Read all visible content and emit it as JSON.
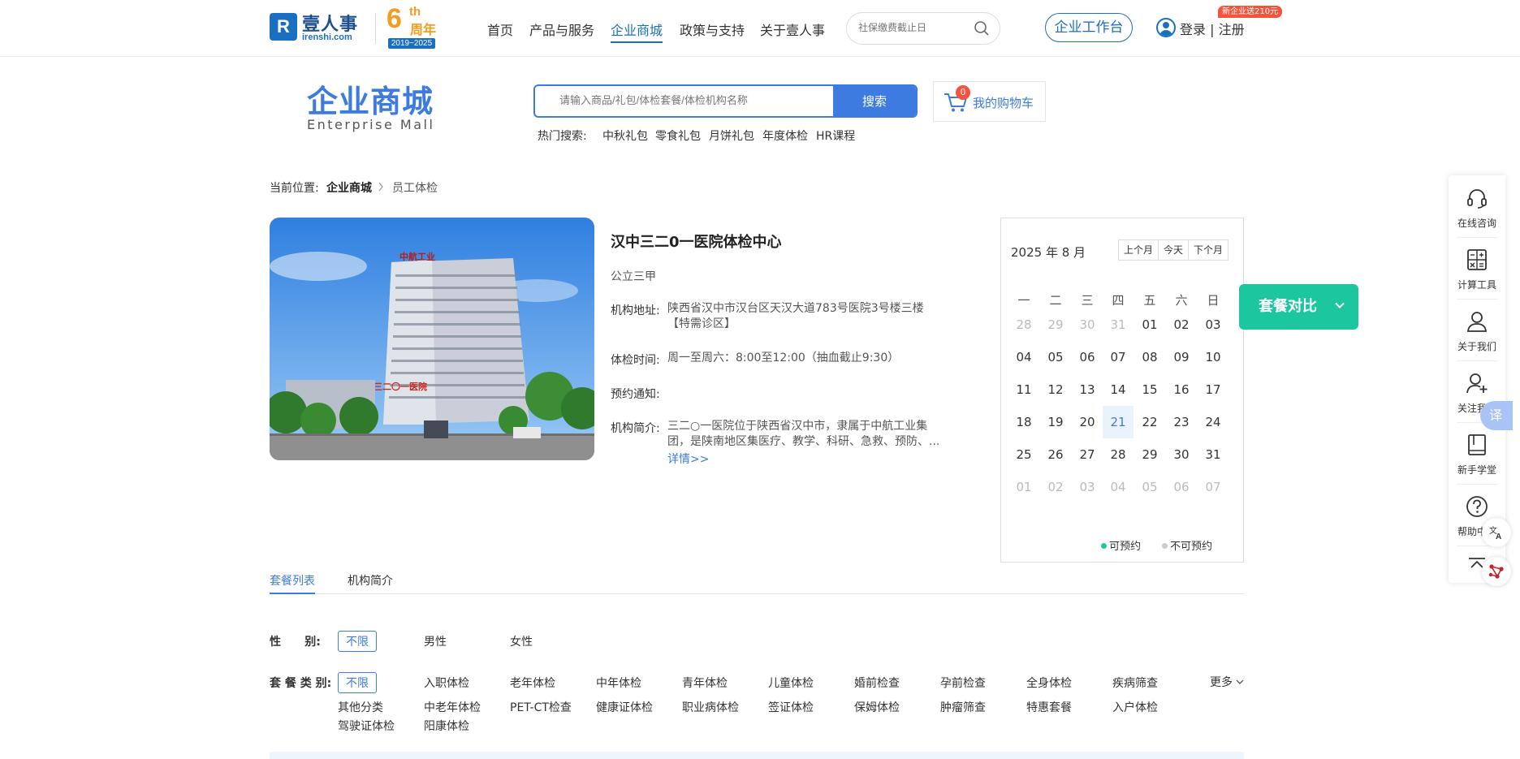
{
  "brand": {
    "name": "壹人事",
    "domain": "irenshi.com",
    "anniversary_num": "6",
    "anniversary_suffix": "th",
    "anniversary_label": "周年",
    "anniversary_years": "2019~2025"
  },
  "nav": {
    "items": [
      {
        "label": "首页",
        "active": false
      },
      {
        "label": "产品与服务",
        "active": false
      },
      {
        "label": "企业商城",
        "active": true
      },
      {
        "label": "政策与支持",
        "active": false
      },
      {
        "label": "关于壹人事",
        "active": false
      }
    ],
    "search_placeholder": "社保缴费截止日",
    "workbench_label": "企业工作台",
    "login_label": "登录 | 注册",
    "promo_badge": "新企业送210元"
  },
  "mall": {
    "title": "企业商城",
    "subtitle": "Enterprise  Mall",
    "search_placeholder": "请输入商品/礼包/体检套餐/体检机构名称",
    "search_button": "搜索",
    "cart_label": "我的购物车",
    "cart_count": "0",
    "hot_label": "热门搜索:",
    "hot_items": [
      "中秋礼包",
      "零食礼包",
      "月饼礼包",
      "年度体检",
      "HR课程"
    ]
  },
  "breadcrumb": {
    "prefix": "当前位置:",
    "items": [
      "企业商城",
      "员工体检"
    ]
  },
  "hospital": {
    "name": "汉中三二0一医院体检中心",
    "level": "公立三甲",
    "address_label": "机构地址:",
    "address_value": "陕西省汉中市汉台区天汉大道783号医院3号楼三楼【特需诊区】",
    "hours_label": "体检时间:",
    "hours_value": "周一至周六：8:00至12:00（抽血截止9:30）",
    "notice_label": "预约通知:",
    "notice_value": "",
    "intro_label": "机构简介:",
    "intro_value": "三二○一医院位于陕西省汉中市，隶属于中航工业集团，是陕南地区集医疗、教学、科研、急救、预防、...",
    "detail_link": "详情>>",
    "photo_sign": "中航工业",
    "photo_banner": "三二〇一医院"
  },
  "calendar": {
    "title": "2025 年 8 月",
    "buttons": [
      "上个月",
      "今天",
      "下个月"
    ],
    "weekdays": [
      "一",
      "二",
      "三",
      "四",
      "五",
      "六",
      "日"
    ],
    "weeks": [
      [
        {
          "d": "28",
          "dim": true
        },
        {
          "d": "29",
          "dim": true
        },
        {
          "d": "30",
          "dim": true
        },
        {
          "d": "31",
          "dim": true
        },
        {
          "d": "01"
        },
        {
          "d": "02"
        },
        {
          "d": "03"
        }
      ],
      [
        {
          "d": "04"
        },
        {
          "d": "05"
        },
        {
          "d": "06"
        },
        {
          "d": "07"
        },
        {
          "d": "08"
        },
        {
          "d": "09"
        },
        {
          "d": "10"
        }
      ],
      [
        {
          "d": "11"
        },
        {
          "d": "12"
        },
        {
          "d": "13"
        },
        {
          "d": "14"
        },
        {
          "d": "15"
        },
        {
          "d": "16"
        },
        {
          "d": "17"
        }
      ],
      [
        {
          "d": "18"
        },
        {
          "d": "19"
        },
        {
          "d": "20"
        },
        {
          "d": "21",
          "today": true
        },
        {
          "d": "22"
        },
        {
          "d": "23"
        },
        {
          "d": "24"
        }
      ],
      [
        {
          "d": "25"
        },
        {
          "d": "26"
        },
        {
          "d": "27"
        },
        {
          "d": "28"
        },
        {
          "d": "29"
        },
        {
          "d": "30"
        },
        {
          "d": "31"
        }
      ],
      [
        {
          "d": "01",
          "dim": true
        },
        {
          "d": "02",
          "dim": true
        },
        {
          "d": "03",
          "dim": true
        },
        {
          "d": "04",
          "dim": true
        },
        {
          "d": "05",
          "dim": true
        },
        {
          "d": "06",
          "dim": true
        },
        {
          "d": "07",
          "dim": true
        }
      ]
    ],
    "legend_available": "可预约",
    "legend_unavailable": "不可预约",
    "available_color": "#1cc7a0",
    "unavailable_color": "#cccccc"
  },
  "compare_button": "套餐对比",
  "tabs": [
    {
      "label": "套餐列表",
      "active": true
    },
    {
      "label": "机构简介",
      "active": false
    }
  ],
  "filters": {
    "gender_label": "性      别:",
    "gender_options": [
      "不限",
      "男性",
      "女性"
    ],
    "category_label": "套 餐 类 别:",
    "category_options": [
      "不限",
      "入职体检",
      "老年体检",
      "中年体检",
      "青年体检",
      "儿童体检",
      "婚前检查",
      "孕前检查",
      "全身体检",
      "疾病筛查",
      "其他分类",
      "中老年体检",
      "PET-CT检查",
      "健康证体检",
      "职业病体检",
      "签证体检",
      "保姆体检",
      "肿瘤筛查",
      "特惠套餐",
      "入户体检",
      "驾驶证体检",
      "阳康体检"
    ],
    "more_label": "更多"
  },
  "sidebar": {
    "items": [
      {
        "label": "在线咨询",
        "icon": "headset-icon"
      },
      {
        "label": "计算工具",
        "icon": "calculator-icon"
      },
      {
        "label": "关于我们",
        "icon": "person-icon"
      },
      {
        "label": "关注我们",
        "icon": "add-person-icon"
      },
      {
        "label": "新手学堂",
        "icon": "book-icon"
      },
      {
        "label": "帮助中心",
        "icon": "help-icon"
      }
    ],
    "translate_label": "译"
  },
  "colors": {
    "brand_blue": "#1b6fc0",
    "accent_blue": "#3d7be0",
    "green": "#1cc7a0",
    "anniversary_orange": "#f39c1f",
    "badge_red": "#f5533d"
  }
}
